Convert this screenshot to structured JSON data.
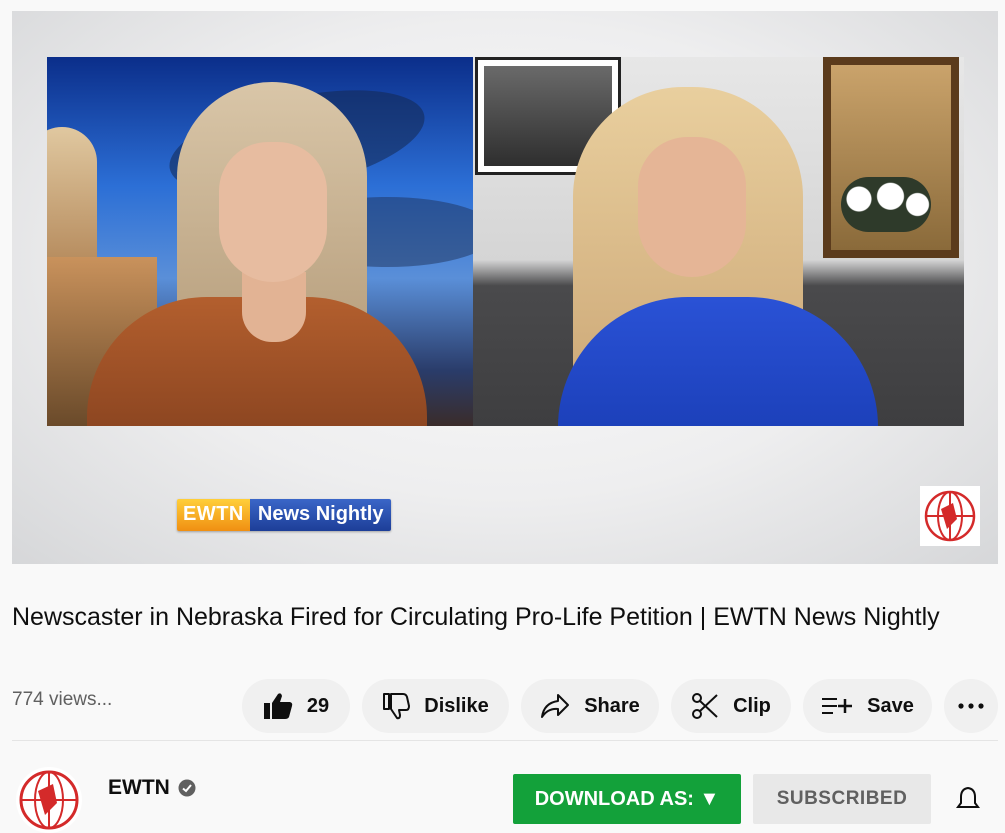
{
  "video": {
    "logo_left": "EWTN",
    "logo_right": "News Nightly"
  },
  "title": "Newscaster in Nebraska Fired for Circulating Pro-Life Petition | EWTN News Nightly",
  "views": "774 views...",
  "actions": {
    "like_count": "29",
    "dislike_label": "Dislike",
    "share_label": "Share",
    "clip_label": "Clip",
    "save_label": "Save"
  },
  "channel": {
    "name": "EWTN",
    "verified": true
  },
  "buttons": {
    "download": "DOWNLOAD AS: ▼",
    "subscribed": "SUBSCRIBED"
  },
  "colors": {
    "download_bg": "#13a13a",
    "pill_bg": "#f0f0f0",
    "logo_red": "#d42a2a"
  }
}
